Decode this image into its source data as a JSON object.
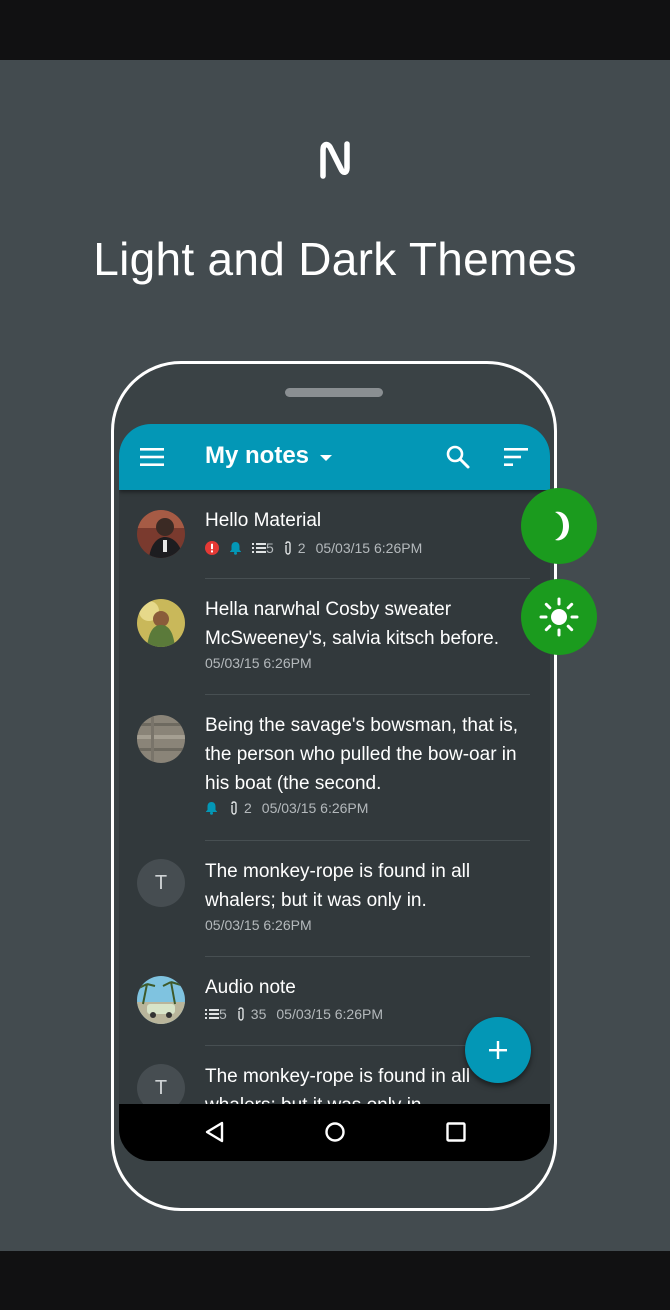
{
  "promo": {
    "logo_letter": "N",
    "headline": "Light and Dark Themes"
  },
  "appbar": {
    "title": "My notes",
    "icons": [
      "menu-icon",
      "caret-down-icon",
      "search-icon",
      "sort-icon"
    ]
  },
  "notes": [
    {
      "title": "Hello Material",
      "meta": {
        "checklist_count": "5",
        "attachment_count": "2",
        "date": "05/03/15 6:26PM"
      },
      "icons": [
        "alert-icon",
        "bell-icon",
        "checklist-icon",
        "attachment-icon"
      ]
    },
    {
      "title": "Hella narwhal Cosby sweater McSweeney's, salvia kitsch before.",
      "meta": {
        "date": "05/03/15 6:26PM"
      }
    },
    {
      "title": "Being the savage's bowsman, that is, the person who pulled the bow-oar in his boat (the second.",
      "meta": {
        "attachment_count": "2",
        "date": "05/03/15 6:26PM"
      },
      "icons": [
        "bell-icon",
        "attachment-icon"
      ]
    },
    {
      "avatar_letter": "T",
      "title": "The monkey-rope is found in all whalers; but it was only in.",
      "meta": {
        "date": "05/03/15 6:26PM"
      }
    },
    {
      "title": "Audio note",
      "meta": {
        "checklist_count": "5",
        "attachment_count": "35",
        "date": "05/03/15 6:26PM"
      },
      "icons": [
        "checklist-icon",
        "attachment-icon"
      ]
    },
    {
      "avatar_letter": "T",
      "title": "The monkey-rope is found in all whalers; but it was only in."
    }
  ],
  "fab": {
    "icon": "plus-icon"
  },
  "theme_buttons": {
    "dark_icon": "moon-icon",
    "light_icon": "sun-icon"
  },
  "navbar": {
    "icons": [
      "back-icon",
      "home-icon",
      "recents-icon"
    ]
  },
  "colors": {
    "accent": "#0397b6",
    "theme_button": "#1b9b1e",
    "background": "#434b4f",
    "screen": "#32393c",
    "alert": "#e53935",
    "bell": "#0397b6"
  }
}
